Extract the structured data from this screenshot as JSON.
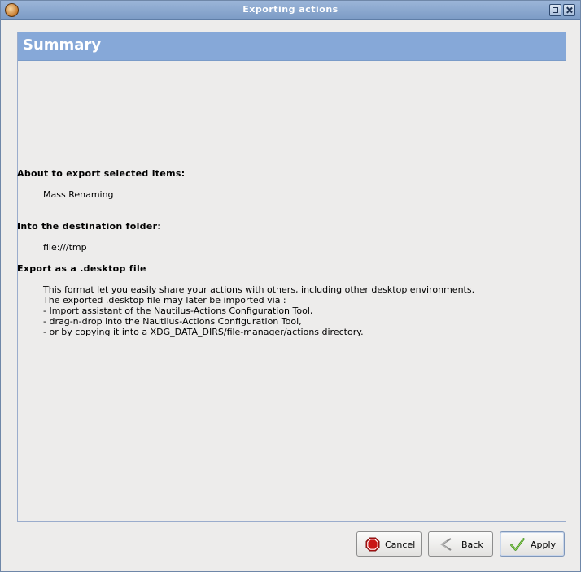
{
  "window": {
    "title": "Exporting actions",
    "icons": {
      "app": "nautilus-actions-app-icon",
      "maximize": "maximize-icon",
      "close": "close-icon"
    }
  },
  "page": {
    "title": "Summary",
    "items_heading": "About to export selected items:",
    "items_value": "Mass Renaming",
    "folder_heading": "Into the destination folder:",
    "folder_value": "file:///tmp",
    "format_heading": "Export as a .desktop file",
    "format_description": [
      "This format let you easily share your actions with others, including other desktop environments.",
      "The exported .desktop file may later be imported via :",
      "- Import assistant of the Nautilus-Actions Configuration Tool,",
      "- drag-n-drop into the Nautilus-Actions Configuration Tool,",
      "- or by copying it into a XDG_DATA_DIRS/file-manager/actions directory."
    ]
  },
  "buttons": {
    "cancel": {
      "label": "Cancel",
      "icon": "stop-icon"
    },
    "back": {
      "label": "Back",
      "icon": "back-arrow-icon"
    },
    "apply": {
      "label": "Apply",
      "icon": "checkmark-icon"
    }
  },
  "colors": {
    "header": "#86a8d8",
    "titlebar": "#86a6d0",
    "background": "#edeceb"
  }
}
